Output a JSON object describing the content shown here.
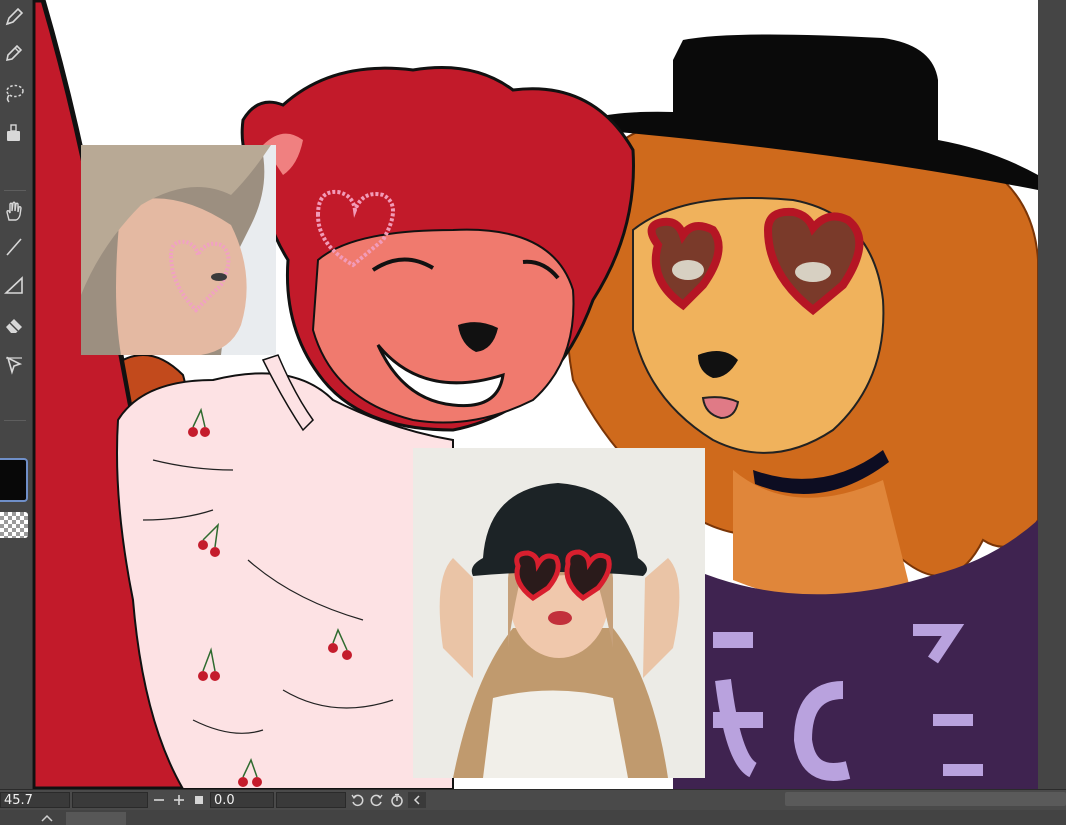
{
  "toolbar": {
    "tools": [
      {
        "name": "pen-tool-icon"
      },
      {
        "name": "pencil-tool-icon"
      },
      {
        "name": "lasso-tool-icon"
      },
      {
        "name": "fill-bucket-tool-icon"
      },
      {
        "name": "hand-tool-icon"
      },
      {
        "name": "line-tool-icon"
      },
      {
        "name": "gradient-tool-icon"
      },
      {
        "name": "eraser-tool-icon"
      },
      {
        "name": "move-tool-icon"
      }
    ],
    "main_color": "#080808",
    "sub_color": "transparent"
  },
  "status_bar": {
    "zoom_value": "45.7",
    "rotation_value": "0.0"
  },
  "colors": {
    "accent": "#6f8fc8",
    "panel": "#464646",
    "canvas": "#ffffff",
    "red_bear": "#c21a2a",
    "orange_dog": "#d9731f",
    "purple_shirt": "#3f2350"
  }
}
